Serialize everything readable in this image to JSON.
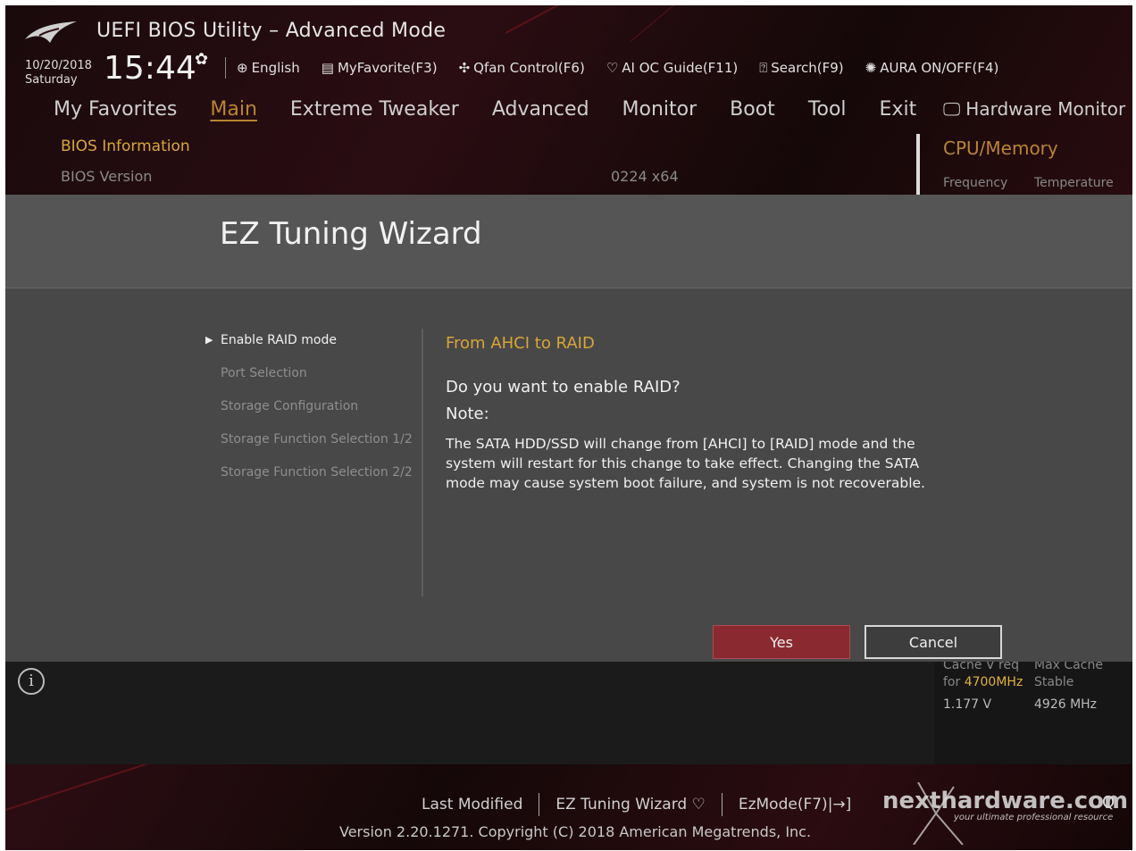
{
  "header": {
    "title": "UEFI BIOS Utility – Advanced Mode",
    "date": "10/20/2018",
    "weekday": "Saturday",
    "time": "15:44",
    "toolbar": {
      "language": "English",
      "myfavorite": "MyFavorite(F3)",
      "qfan": "Qfan Control(F6)",
      "aioc": "AI OC Guide(F11)",
      "search": "Search(F9)",
      "aura": "AURA ON/OFF(F4)"
    }
  },
  "nav": {
    "tabs": [
      "My Favorites",
      "Main",
      "Extreme Tweaker",
      "Advanced",
      "Monitor",
      "Boot",
      "Tool",
      "Exit"
    ],
    "active": "Main",
    "hardware_monitor": "Hardware Monitor"
  },
  "main": {
    "section": "BIOS Information",
    "bios_version_label": "BIOS Version",
    "bios_version_value": "0224  x64"
  },
  "hwmon": {
    "group": "CPU/Memory",
    "frequency_label": "Frequency",
    "temperature_label": "Temperature",
    "cache_v_req_label": "Cache V req",
    "for_prefix": "for",
    "for_freq": "4700MHz",
    "cache_v_value": "1.177 V",
    "max_cache_label": "Max Cache",
    "stable_label": "Stable",
    "max_cache_value": "4926 MHz"
  },
  "wizard": {
    "title": "EZ Tuning Wizard",
    "steps": [
      "Enable RAID mode",
      "Port Selection",
      "Storage Configuration",
      "Storage Function Selection 1/2",
      "Storage Function Selection 2/2"
    ],
    "active_step": 0,
    "content_title": "From AHCI to RAID",
    "question": "Do you want to enable RAID?",
    "note_label": "Note:",
    "note_text": "The SATA HDD/SSD will change from [AHCI] to [RAID] mode and the system will restart for this change to take effect. Changing the SATA mode may cause system boot failure, and system is not recoverable.",
    "yes_label": "Yes",
    "cancel_label": "Cancel"
  },
  "footer": {
    "last_modified": "Last Modified",
    "ez_tuning": "EZ Tuning Wizard",
    "ezmode": "EzMode(F7)",
    "version": "Version 2.20.1271. Copyright (C) 2018 American Megatrends, Inc.",
    "faq": "Q"
  },
  "watermark": {
    "text": "nexthardware.com",
    "subtitle": "your ultimate professional resource"
  },
  "colors": {
    "accent_gold": "#d9a537",
    "active_tab": "#b9852e",
    "yes_button": "#8a2a30",
    "modal_bg": "#484848"
  }
}
